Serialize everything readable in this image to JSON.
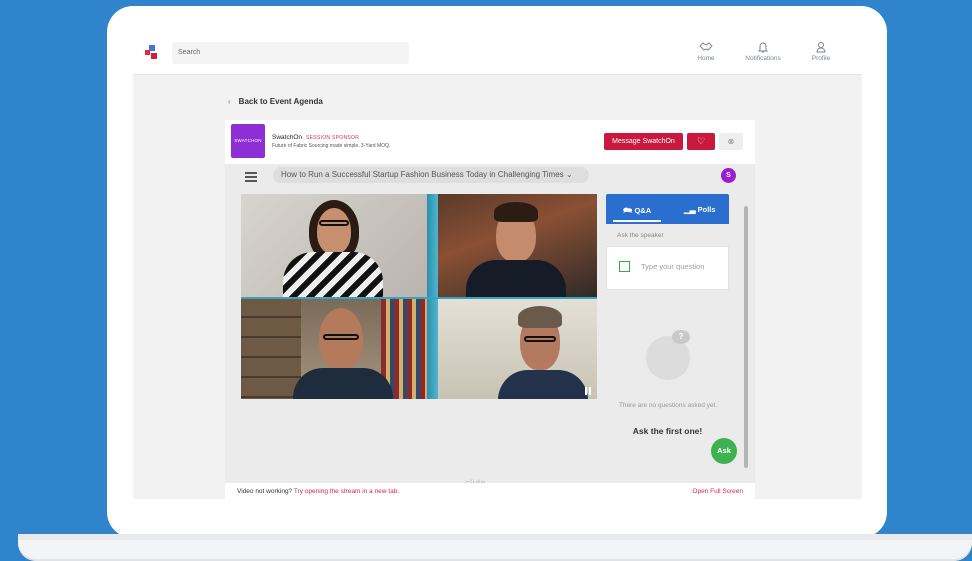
{
  "topbar": {
    "search_placeholder": "Search",
    "nav": [
      {
        "label": "Home",
        "icon": "handshake-icon"
      },
      {
        "label": "Notifications",
        "icon": "bell-icon"
      },
      {
        "label": "Profile",
        "icon": "user-icon"
      }
    ]
  },
  "back_link": "Back to Event Agenda",
  "sponsor": {
    "logo_text": "SWATCHON",
    "name": "SwatchOn",
    "tag": "SESSION SPONSOR",
    "description": "Future of Fabric Sourcing made simple. 3-Yard MOQ.",
    "message_button": "Message SwatchOn"
  },
  "session": {
    "title": "How to Run a Successful Startup Fashion Business Today in Challenging Times",
    "avatar_initial": "S"
  },
  "qa": {
    "tab_qa": "Q&A",
    "tab_polls": "Polls",
    "ask_speaker": "Ask the speaker",
    "input_placeholder": "Type your question",
    "empty_text": "There are no questions asked yet.",
    "empty_cta": "Ask the first one!",
    "ask_button": "Ask",
    "empty_icon_glyph": "?"
  },
  "branding": "slido",
  "footer": {
    "prefix": "Video not working?",
    "link": "Try opening the stream in a new tab.",
    "fullscreen": "Open Full Screen"
  }
}
